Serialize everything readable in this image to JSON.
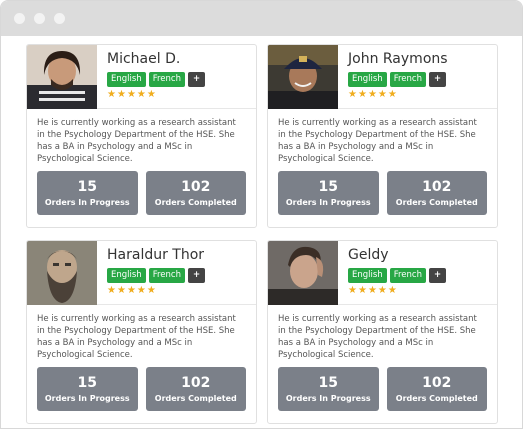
{
  "profiles": [
    {
      "name": "Michael D.",
      "languages": [
        "English",
        "French"
      ],
      "more_label": "+",
      "rating": 5,
      "description": "He is currently working as a research assistant in the Psychology Department of the HSE. She has a BA in Psychology and a MSc in Psychological Science.",
      "stats": [
        {
          "value": "15",
          "label": "Orders In Progress"
        },
        {
          "value": "102",
          "label": "Orders Completed"
        }
      ]
    },
    {
      "name": "John Raymons",
      "languages": [
        "English",
        "French"
      ],
      "more_label": "+",
      "rating": 5,
      "description": "He is currently working as a research assistant in the Psychology Department of the HSE. She has a BA in Psychology and a MSc in Psychological Science.",
      "stats": [
        {
          "value": "15",
          "label": "Orders In Progress"
        },
        {
          "value": "102",
          "label": "Orders Completed"
        }
      ]
    },
    {
      "name": "Haraldur Thor",
      "languages": [
        "English",
        "French"
      ],
      "more_label": "+",
      "rating": 5,
      "description": "He is currently working as a research assistant in the Psychology Department of the HSE. She has a BA in Psychology and a MSc in Psychological Science.",
      "stats": [
        {
          "value": "15",
          "label": "Orders In Progress"
        },
        {
          "value": "102",
          "label": "Orders Completed"
        }
      ]
    },
    {
      "name": "Geldy",
      "languages": [
        "English",
        "French"
      ],
      "more_label": "+",
      "rating": 5,
      "description": "He is currently working as a research assistant in the Psychology Department of the HSE. She has a BA in Psychology and a MSc in Psychological Science.",
      "stats": [
        {
          "value": "15",
          "label": "Orders In Progress"
        },
        {
          "value": "102",
          "label": "Orders Completed"
        }
      ]
    }
  ],
  "colors": {
    "language_tag": "#28a745",
    "more_tag": "#444444",
    "star": "#f0ad1e",
    "stat_box": "#7b8089"
  }
}
